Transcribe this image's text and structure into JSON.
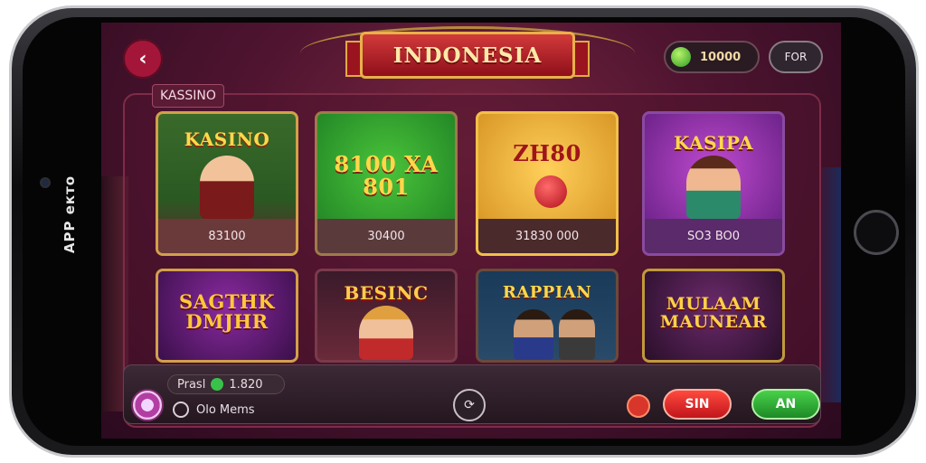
{
  "device": {
    "side_label": "APP екто"
  },
  "header": {
    "title": "INDONESIA",
    "coins": "10000",
    "right_button": "FOR"
  },
  "section": {
    "label": "KASSINO"
  },
  "games": [
    {
      "title": "KASINO",
      "value": "83100",
      "accent": "#2e8a2a"
    },
    {
      "title": "8100 XA 801",
      "value": "30400",
      "accent": "#1f9a2e"
    },
    {
      "title": "ZH80",
      "value": "31830 000",
      "accent": "#e0a428"
    },
    {
      "title": "KASIPA",
      "value": "SO3 BO0",
      "accent": "#7a2aa8"
    },
    {
      "title": "SAGTHK DMJHR",
      "value": "",
      "accent": "#6a2486"
    },
    {
      "title": "BESINC",
      "value": "",
      "accent": "#8a1a2a"
    },
    {
      "title": "RAPPIAN",
      "value": "",
      "accent": "#1e3a5a"
    },
    {
      "title": "MULAAM MAUNEAR",
      "value": "",
      "accent": "#4a1a5a"
    }
  ],
  "bottom_bar": {
    "player_label": "Prasl",
    "player_value": "1.820",
    "mode_label": "Olo Mems",
    "red_small": "",
    "red_button": "SIN",
    "green_button": "AN"
  }
}
